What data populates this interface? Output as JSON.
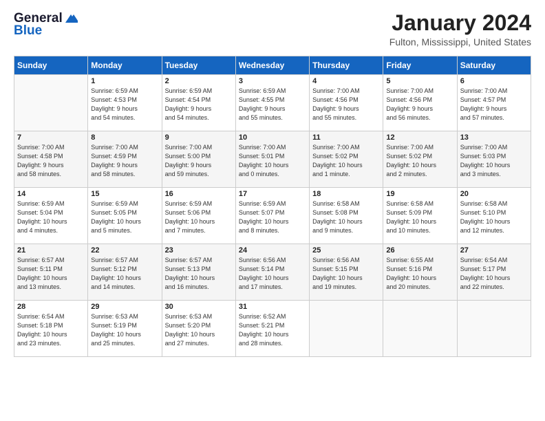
{
  "header": {
    "logo_line1": "General",
    "logo_line2": "Blue",
    "title": "January 2024",
    "subtitle": "Fulton, Mississippi, United States"
  },
  "days_of_week": [
    "Sunday",
    "Monday",
    "Tuesday",
    "Wednesday",
    "Thursday",
    "Friday",
    "Saturday"
  ],
  "weeks": [
    [
      {
        "num": "",
        "info": ""
      },
      {
        "num": "1",
        "info": "Sunrise: 6:59 AM\nSunset: 4:53 PM\nDaylight: 9 hours\nand 54 minutes."
      },
      {
        "num": "2",
        "info": "Sunrise: 6:59 AM\nSunset: 4:54 PM\nDaylight: 9 hours\nand 54 minutes."
      },
      {
        "num": "3",
        "info": "Sunrise: 6:59 AM\nSunset: 4:55 PM\nDaylight: 9 hours\nand 55 minutes."
      },
      {
        "num": "4",
        "info": "Sunrise: 7:00 AM\nSunset: 4:56 PM\nDaylight: 9 hours\nand 55 minutes."
      },
      {
        "num": "5",
        "info": "Sunrise: 7:00 AM\nSunset: 4:56 PM\nDaylight: 9 hours\nand 56 minutes."
      },
      {
        "num": "6",
        "info": "Sunrise: 7:00 AM\nSunset: 4:57 PM\nDaylight: 9 hours\nand 57 minutes."
      }
    ],
    [
      {
        "num": "7",
        "info": "Sunrise: 7:00 AM\nSunset: 4:58 PM\nDaylight: 9 hours\nand 58 minutes."
      },
      {
        "num": "8",
        "info": "Sunrise: 7:00 AM\nSunset: 4:59 PM\nDaylight: 9 hours\nand 58 minutes."
      },
      {
        "num": "9",
        "info": "Sunrise: 7:00 AM\nSunset: 5:00 PM\nDaylight: 9 hours\nand 59 minutes."
      },
      {
        "num": "10",
        "info": "Sunrise: 7:00 AM\nSunset: 5:01 PM\nDaylight: 10 hours\nand 0 minutes."
      },
      {
        "num": "11",
        "info": "Sunrise: 7:00 AM\nSunset: 5:02 PM\nDaylight: 10 hours\nand 1 minute."
      },
      {
        "num": "12",
        "info": "Sunrise: 7:00 AM\nSunset: 5:02 PM\nDaylight: 10 hours\nand 2 minutes."
      },
      {
        "num": "13",
        "info": "Sunrise: 7:00 AM\nSunset: 5:03 PM\nDaylight: 10 hours\nand 3 minutes."
      }
    ],
    [
      {
        "num": "14",
        "info": "Sunrise: 6:59 AM\nSunset: 5:04 PM\nDaylight: 10 hours\nand 4 minutes."
      },
      {
        "num": "15",
        "info": "Sunrise: 6:59 AM\nSunset: 5:05 PM\nDaylight: 10 hours\nand 5 minutes."
      },
      {
        "num": "16",
        "info": "Sunrise: 6:59 AM\nSunset: 5:06 PM\nDaylight: 10 hours\nand 7 minutes."
      },
      {
        "num": "17",
        "info": "Sunrise: 6:59 AM\nSunset: 5:07 PM\nDaylight: 10 hours\nand 8 minutes."
      },
      {
        "num": "18",
        "info": "Sunrise: 6:58 AM\nSunset: 5:08 PM\nDaylight: 10 hours\nand 9 minutes."
      },
      {
        "num": "19",
        "info": "Sunrise: 6:58 AM\nSunset: 5:09 PM\nDaylight: 10 hours\nand 10 minutes."
      },
      {
        "num": "20",
        "info": "Sunrise: 6:58 AM\nSunset: 5:10 PM\nDaylight: 10 hours\nand 12 minutes."
      }
    ],
    [
      {
        "num": "21",
        "info": "Sunrise: 6:57 AM\nSunset: 5:11 PM\nDaylight: 10 hours\nand 13 minutes."
      },
      {
        "num": "22",
        "info": "Sunrise: 6:57 AM\nSunset: 5:12 PM\nDaylight: 10 hours\nand 14 minutes."
      },
      {
        "num": "23",
        "info": "Sunrise: 6:57 AM\nSunset: 5:13 PM\nDaylight: 10 hours\nand 16 minutes."
      },
      {
        "num": "24",
        "info": "Sunrise: 6:56 AM\nSunset: 5:14 PM\nDaylight: 10 hours\nand 17 minutes."
      },
      {
        "num": "25",
        "info": "Sunrise: 6:56 AM\nSunset: 5:15 PM\nDaylight: 10 hours\nand 19 minutes."
      },
      {
        "num": "26",
        "info": "Sunrise: 6:55 AM\nSunset: 5:16 PM\nDaylight: 10 hours\nand 20 minutes."
      },
      {
        "num": "27",
        "info": "Sunrise: 6:54 AM\nSunset: 5:17 PM\nDaylight: 10 hours\nand 22 minutes."
      }
    ],
    [
      {
        "num": "28",
        "info": "Sunrise: 6:54 AM\nSunset: 5:18 PM\nDaylight: 10 hours\nand 23 minutes."
      },
      {
        "num": "29",
        "info": "Sunrise: 6:53 AM\nSunset: 5:19 PM\nDaylight: 10 hours\nand 25 minutes."
      },
      {
        "num": "30",
        "info": "Sunrise: 6:53 AM\nSunset: 5:20 PM\nDaylight: 10 hours\nand 27 minutes."
      },
      {
        "num": "31",
        "info": "Sunrise: 6:52 AM\nSunset: 5:21 PM\nDaylight: 10 hours\nand 28 minutes."
      },
      {
        "num": "",
        "info": ""
      },
      {
        "num": "",
        "info": ""
      },
      {
        "num": "",
        "info": ""
      }
    ]
  ]
}
